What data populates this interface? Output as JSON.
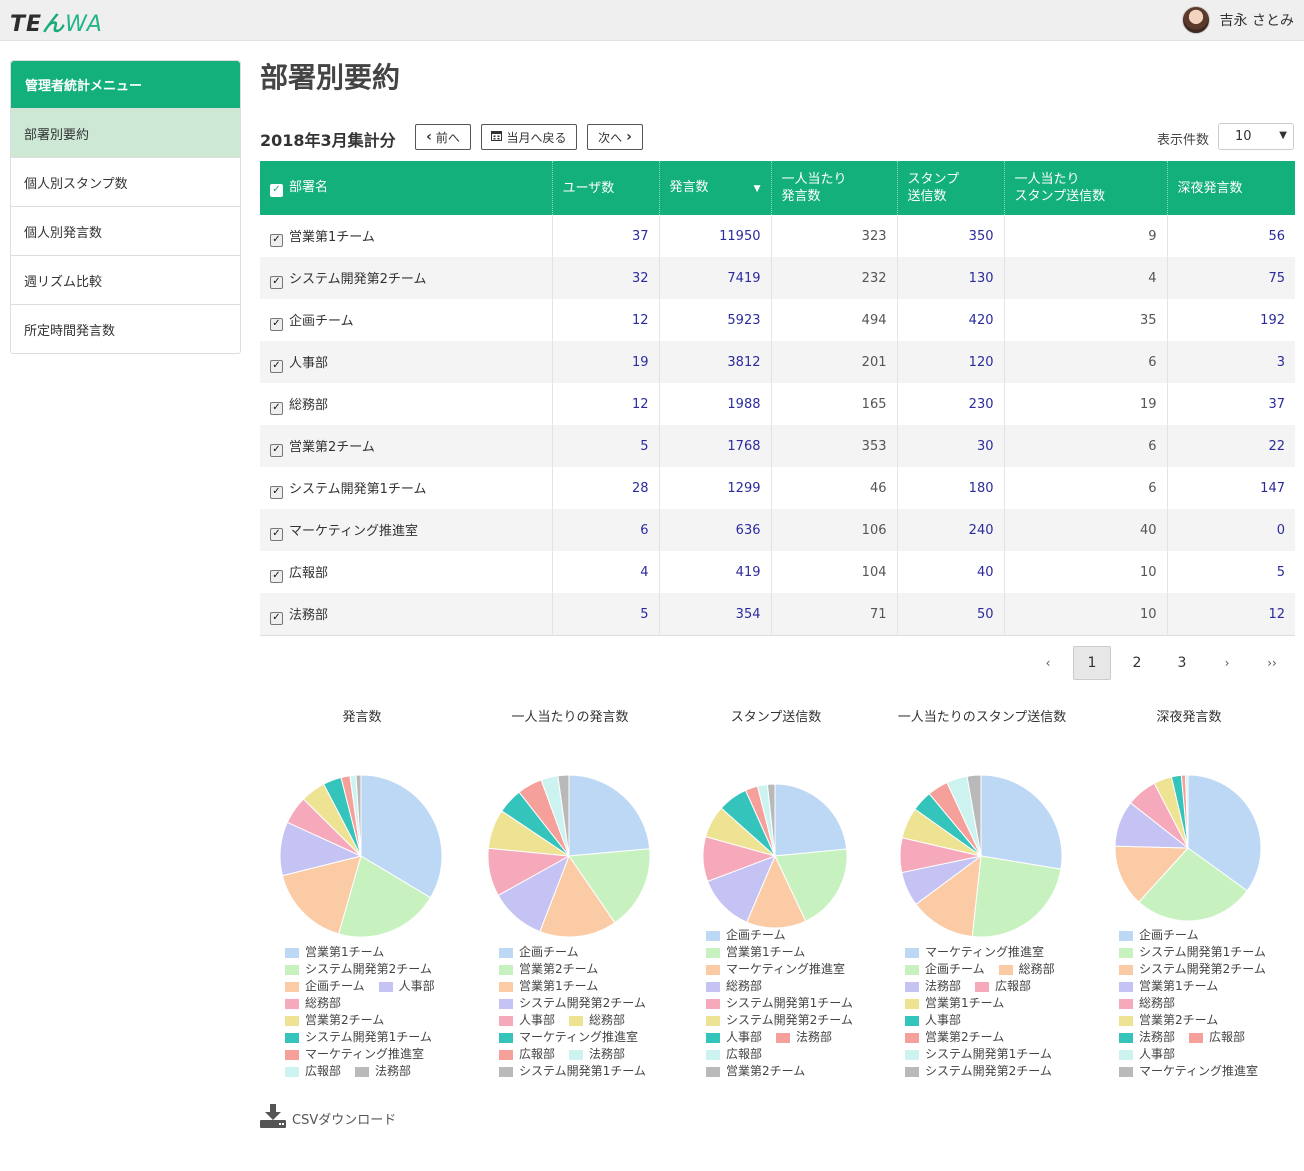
{
  "header": {
    "logo_main": "TE",
    "logo_n": "ん",
    "logo_tail": "WA",
    "user_name": "吉永 さとみ"
  },
  "sidebar": {
    "title": "管理者統計メニュー",
    "items": [
      {
        "label": "部署別要約"
      },
      {
        "label": "個人別スタンプ数"
      },
      {
        "label": "個人別発言数"
      },
      {
        "label": "週リズム比較"
      },
      {
        "label": "所定時間発言数"
      }
    ]
  },
  "page": {
    "title": "部署別要約",
    "period": "2018年3月集計分",
    "prev_label": "前へ",
    "current_label": "当月へ戻る",
    "next_label": "次へ",
    "count_label": "表示件数",
    "count_value": "10"
  },
  "table": {
    "headers": [
      "部署名",
      "ユーザ数",
      "発言数",
      "一人当たり\n発言数",
      "スタンプ\n送信数",
      "一人当たり\nスタンプ送信数",
      "深夜発言数"
    ],
    "rows": [
      [
        "営業第1チーム",
        "37",
        "11950",
        "323",
        "350",
        "9",
        "56"
      ],
      [
        "システム開発第2チーム",
        "32",
        "7419",
        "232",
        "130",
        "4",
        "75"
      ],
      [
        "企画チーム",
        "12",
        "5923",
        "494",
        "420",
        "35",
        "192"
      ],
      [
        "人事部",
        "19",
        "3812",
        "201",
        "120",
        "6",
        "3"
      ],
      [
        "総務部",
        "12",
        "1988",
        "165",
        "230",
        "19",
        "37"
      ],
      [
        "営業第2チーム",
        "5",
        "1768",
        "353",
        "30",
        "6",
        "22"
      ],
      [
        "システム開発第1チーム",
        "28",
        "1299",
        "46",
        "180",
        "6",
        "147"
      ],
      [
        "マーケティング推進室",
        "6",
        "636",
        "106",
        "240",
        "40",
        "0"
      ],
      [
        "広報部",
        "4",
        "419",
        "104",
        "40",
        "10",
        "5"
      ],
      [
        "法務部",
        "5",
        "354",
        "71",
        "50",
        "10",
        "12"
      ]
    ]
  },
  "pagination": {
    "prev": "‹",
    "pages": [
      "1",
      "2",
      "3"
    ],
    "next": "›",
    "last": "››",
    "current": "1"
  },
  "csv_label": "CSVダウンロード",
  "colors": {
    "accent": "#13b07c",
    "palette": [
      "#bdd8f5",
      "#c7f2c0",
      "#fbcba6",
      "#c5c3f3",
      "#f6a9bb",
      "#eee293",
      "#35c4bc",
      "#f5a09b",
      "#cdf3f1",
      "#b9b9b9"
    ]
  },
  "chart_data": [
    {
      "type": "pie",
      "title": "発言数",
      "categories": [
        "営業第1チーム",
        "システム開発第2チーム",
        "企画チーム",
        "人事部",
        "総務部",
        "営業第2チーム",
        "システム開発第1チーム",
        "マーケティング推進室",
        "広報部",
        "法務部"
      ],
      "values": [
        11950,
        7419,
        5923,
        3812,
        1988,
        1768,
        1299,
        636,
        419,
        354
      ]
    },
    {
      "type": "pie",
      "title": "一人当たりの発言数",
      "categories": [
        "企画チーム",
        "営業第2チーム",
        "営業第1チーム",
        "システム開発第2チーム",
        "人事部",
        "総務部",
        "マーケティング推進室",
        "広報部",
        "法務部",
        "システム開発第1チーム"
      ],
      "values": [
        494,
        353,
        323,
        232,
        201,
        165,
        106,
        104,
        71,
        46
      ]
    },
    {
      "type": "pie",
      "title": "スタンプ送信数",
      "categories": [
        "企画チーム",
        "営業第1チーム",
        "マーケティング推進室",
        "総務部",
        "システム開発第1チーム",
        "システム開発第2チーム",
        "人事部",
        "法務部",
        "広報部",
        "営業第2チーム"
      ],
      "values": [
        420,
        350,
        240,
        230,
        180,
        130,
        120,
        50,
        40,
        30
      ]
    },
    {
      "type": "pie",
      "title": "一人当たりのスタンプ送信数",
      "categories": [
        "マーケティング推進室",
        "企画チーム",
        "総務部",
        "法務部",
        "広報部",
        "営業第1チーム",
        "人事部",
        "営業第2チーム",
        "システム開発第1チーム",
        "システム開発第2チーム"
      ],
      "values": [
        40,
        35,
        19,
        10,
        10,
        9,
        6,
        6,
        6,
        4
      ]
    },
    {
      "type": "pie",
      "title": "深夜発言数",
      "categories": [
        "企画チーム",
        "システム開発第1チーム",
        "システム開発第2チーム",
        "営業第1チーム",
        "総務部",
        "営業第2チーム",
        "法務部",
        "広報部",
        "人事部",
        "マーケティング推進室"
      ],
      "values": [
        192,
        147,
        75,
        56,
        37,
        22,
        12,
        5,
        3,
        0
      ]
    }
  ]
}
